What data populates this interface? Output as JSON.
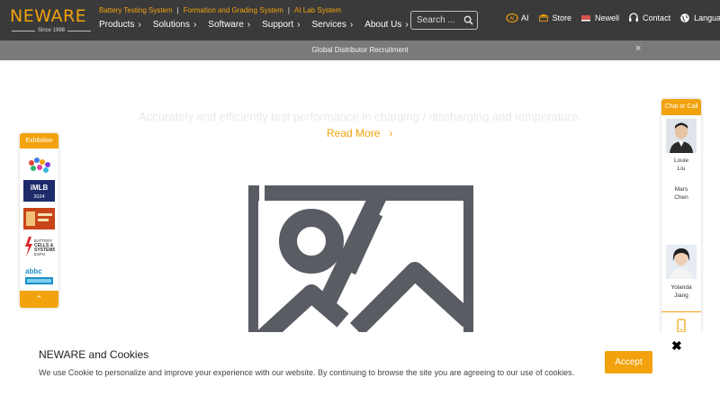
{
  "brand": {
    "name": "NEWARE",
    "since": "Since 1998",
    "color": "#f2a20c"
  },
  "tagline": {
    "items": [
      "Battery Testing System",
      "Formation and Grading System",
      "AI Lab System"
    ],
    "separator": "|"
  },
  "nav": {
    "items": [
      "Products",
      "Solutions",
      "Software",
      "Support",
      "Services",
      "About Us"
    ]
  },
  "search": {
    "placeholder": "Search ..."
  },
  "right_links": {
    "ai": "AI",
    "store": "Store",
    "newell": "Newell",
    "contact": "Contact",
    "language": "Language"
  },
  "announcement": {
    "text": "Global Distributor Recruitment",
    "close": "×"
  },
  "hero": {
    "subtitle": "Accurately and efficiently test performance in charging / discharging and temperature.",
    "read_more": "Read More",
    "read_more_arrow": "›"
  },
  "exhibition": {
    "title": "Exhibition",
    "up_arrow": "⌃"
  },
  "chat": {
    "title": "Chat or Call",
    "agents": [
      {
        "first": "Louie",
        "last": "Liu"
      },
      {
        "first": "Mars",
        "last": "Chen"
      },
      {
        "first": "Yolanda",
        "last": "Jiang"
      }
    ]
  },
  "cookie": {
    "title": "NEWARE and Cookies",
    "text": "We use Cookie to personalize and improve your experience with our website. By continuing to browse the site you are agreeing to our use of cookies.",
    "accept": "Accept",
    "close": "✖"
  },
  "icons": {
    "search": "search-icon",
    "ai": "ai-icon",
    "store": "store-icon",
    "newell": "newell-icon",
    "contact": "headset-icon",
    "language": "globe-icon",
    "placeholder": "image-placeholder-icon",
    "phone": "phone-icon"
  },
  "colors": {
    "header_bg": "#3a3a3a",
    "announce_bg": "#7a7a7a",
    "accent": "#f2a20c"
  }
}
